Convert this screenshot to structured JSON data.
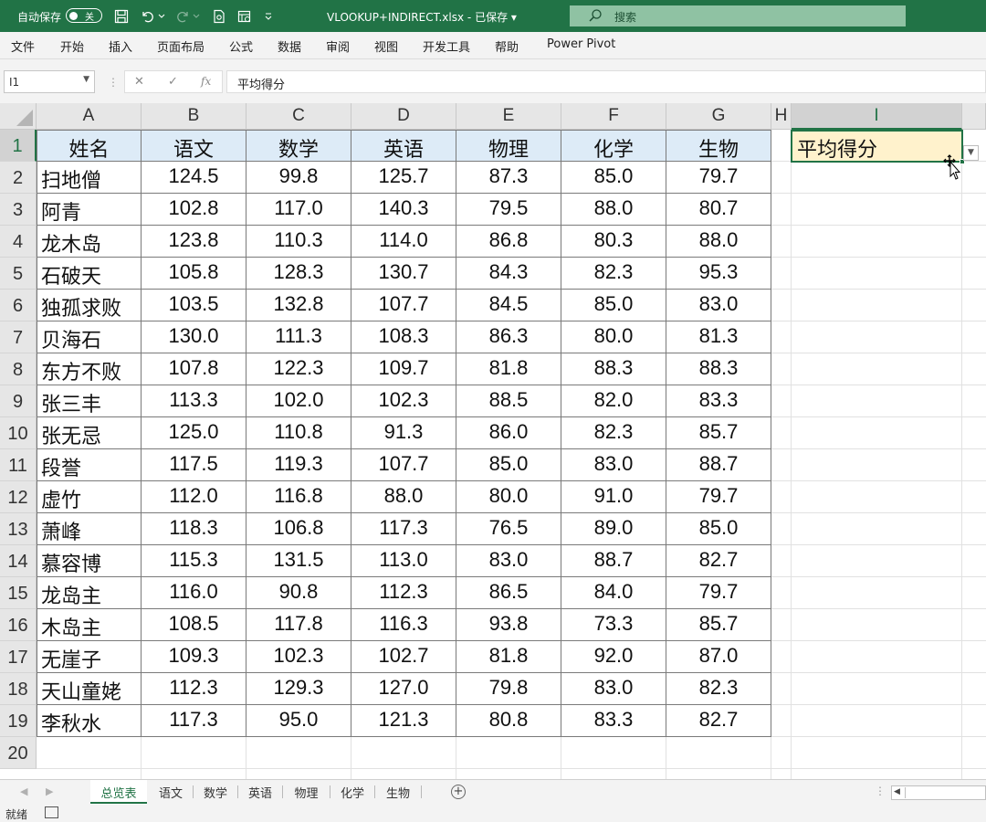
{
  "titlebar": {
    "autosave_label": "自动保存",
    "autosave_state": "关",
    "file_title": "VLOOKUP+INDIRECT.xlsx",
    "save_status": "已保存",
    "search_placeholder": "搜索",
    "accent_color": "#217346"
  },
  "ribbon": {
    "tabs": [
      "文件",
      "开始",
      "插入",
      "页面布局",
      "公式",
      "数据",
      "审阅",
      "视图",
      "开发工具",
      "帮助",
      "Power Pivot"
    ]
  },
  "formula_bar": {
    "name_box": "I1",
    "fx_label": "fx",
    "formula": "平均得分"
  },
  "sheet": {
    "columns": [
      "A",
      "B",
      "C",
      "D",
      "E",
      "F",
      "G",
      "H",
      "I"
    ],
    "selected_column": "I",
    "rows": [
      "1",
      "2",
      "3",
      "4",
      "5",
      "6",
      "7",
      "8",
      "9",
      "10",
      "11",
      "12",
      "13",
      "14",
      "15",
      "16",
      "17",
      "18",
      "19",
      "20"
    ],
    "headers": [
      "姓名",
      "语文",
      "数学",
      "英语",
      "物理",
      "化学",
      "生物"
    ],
    "data": [
      [
        "扫地僧",
        "124.5",
        "99.8",
        "125.7",
        "87.3",
        "85.0",
        "79.7"
      ],
      [
        "阿青",
        "102.8",
        "117.0",
        "140.3",
        "79.5",
        "88.0",
        "80.7"
      ],
      [
        "龙木岛",
        "123.8",
        "110.3",
        "114.0",
        "86.8",
        "80.3",
        "88.0"
      ],
      [
        "石破天",
        "105.8",
        "128.3",
        "130.7",
        "84.3",
        "82.3",
        "95.3"
      ],
      [
        "独孤求败",
        "103.5",
        "132.8",
        "107.7",
        "84.5",
        "85.0",
        "83.0"
      ],
      [
        "贝海石",
        "130.0",
        "111.3",
        "108.3",
        "86.3",
        "80.0",
        "81.3"
      ],
      [
        "东方不败",
        "107.8",
        "122.3",
        "109.7",
        "81.8",
        "88.3",
        "88.3"
      ],
      [
        "张三丰",
        "113.3",
        "102.0",
        "102.3",
        "88.5",
        "82.0",
        "83.3"
      ],
      [
        "张无忌",
        "125.0",
        "110.8",
        "91.3",
        "86.0",
        "82.3",
        "85.7"
      ],
      [
        "段誉",
        "117.5",
        "119.3",
        "107.7",
        "85.0",
        "83.0",
        "88.7"
      ],
      [
        "虚竹",
        "112.0",
        "116.8",
        "88.0",
        "80.0",
        "91.0",
        "79.7"
      ],
      [
        "萧峰",
        "118.3",
        "106.8",
        "117.3",
        "76.5",
        "89.0",
        "85.0"
      ],
      [
        "慕容博",
        "115.3",
        "131.5",
        "113.0",
        "83.0",
        "88.7",
        "82.7"
      ],
      [
        "龙岛主",
        "116.0",
        "90.8",
        "112.3",
        "86.5",
        "84.0",
        "79.7"
      ],
      [
        "木岛主",
        "108.5",
        "117.8",
        "116.3",
        "93.8",
        "73.3",
        "85.7"
      ],
      [
        "无崖子",
        "109.3",
        "102.3",
        "102.7",
        "81.8",
        "92.0",
        "87.0"
      ],
      [
        "天山童姥",
        "112.3",
        "129.3",
        "127.0",
        "79.8",
        "83.0",
        "82.3"
      ],
      [
        "李秋水",
        "117.3",
        "95.0",
        "121.3",
        "80.8",
        "83.3",
        "82.7"
      ]
    ],
    "selected_cell_value": "平均得分",
    "header_fill": "#ddebf7",
    "selected_fill": "#fff2cc"
  },
  "sheet_tabs": {
    "tabs": [
      "总览表",
      "语文",
      "数学",
      "英语",
      "物理",
      "化学",
      "生物"
    ],
    "active": "总览表"
  },
  "statusbar": {
    "ready": "就绪"
  }
}
